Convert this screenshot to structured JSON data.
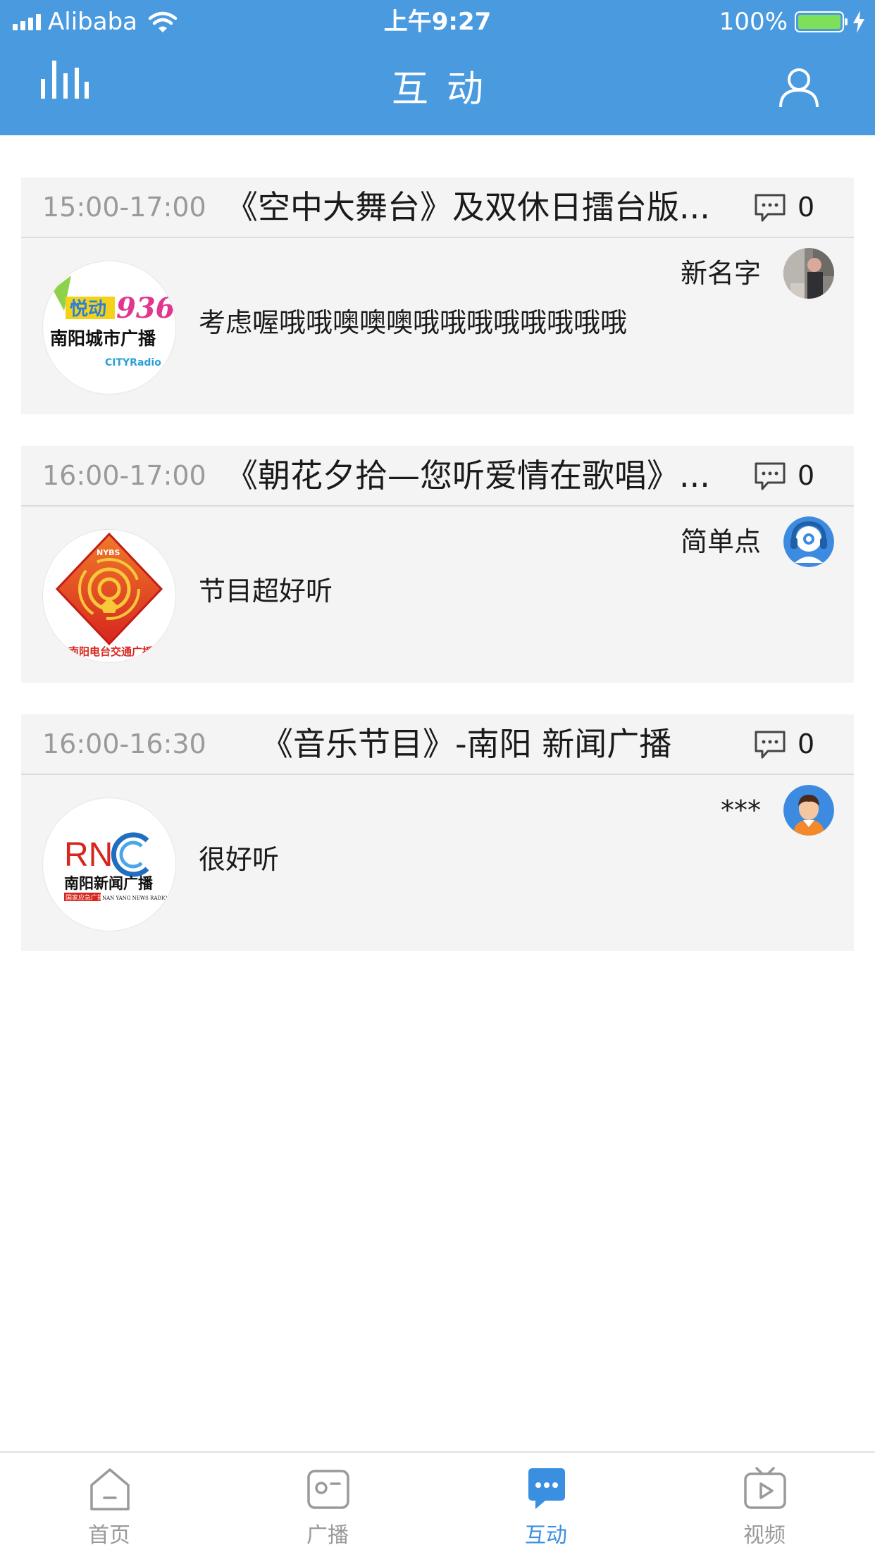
{
  "status_bar": {
    "carrier": "Alibaba",
    "time": "上午9:27",
    "battery": "100%"
  },
  "nav": {
    "title": "互动",
    "left_icon": "chart-bars-icon",
    "right_icon": "user-icon"
  },
  "colors": {
    "header_blue": "#4a9ae0",
    "active_tab": "#3a8fe0",
    "card_bg": "#f4f4f4"
  },
  "cards": [
    {
      "time": "15:00-17:00",
      "title": "《空中大舞台》及双休日擂台版...",
      "comment_count": "0",
      "user_name": "新名字",
      "message": "考虑喔哦哦噢噢噢哦哦哦哦哦哦哦哦",
      "logo": {
        "line1": "悦动",
        "line2": "936",
        "line3": "南阳城市广播",
        "line4": "CITYRadio"
      }
    },
    {
      "time": "16:00-17:00",
      "title": "《朝花夕拾—您听爱情在歌唱》...",
      "comment_count": "0",
      "user_name": "简单点",
      "message": "节目超好听",
      "logo": {
        "line1": "NYBS",
        "line2": "南阳电台交通广播"
      }
    },
    {
      "time": "16:00-16:30",
      "title": "《音乐节目》-南阳 新闻广播",
      "comment_count": "0",
      "user_name": "***",
      "message": "很好听",
      "logo": {
        "line1": "RN",
        "line2": "南阳新闻广播",
        "line3": "国家应急广播",
        "line4": "NAN YANG NEWS RADIO"
      }
    }
  ],
  "tabs": [
    {
      "label": "首页",
      "icon": "home-icon"
    },
    {
      "label": "广播",
      "icon": "radio-icon"
    },
    {
      "label": "互动",
      "icon": "chat-bubble-icon"
    },
    {
      "label": "视频",
      "icon": "tv-play-icon"
    }
  ]
}
